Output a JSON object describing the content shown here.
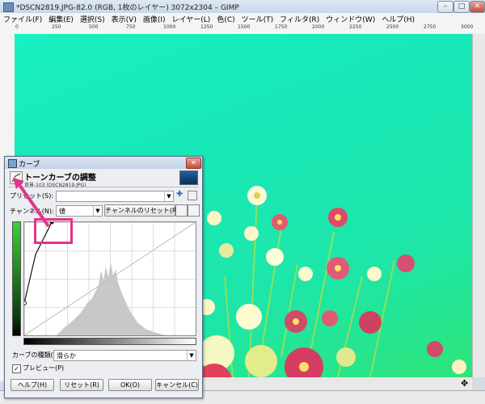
{
  "window": {
    "title": "*DSCN2819.JPG-82.0 (RGB, 1枚のレイヤー) 3072x2304 – GIMP"
  },
  "menu": [
    "ファイル(F)",
    "編集(E)",
    "選択(S)",
    "表示(V)",
    "画像(I)",
    "レイヤー(L)",
    "色(C)",
    "ツール(T)",
    "フィルタ(R)",
    "ウィンドウ(W)",
    "ヘルプ(H)"
  ],
  "ruler": {
    "h_ticks": [
      "0",
      "250",
      "500",
      "750",
      "1000",
      "1250",
      "1500",
      "1750",
      "2000",
      "2250",
      "2500",
      "2750",
      "3000"
    ]
  },
  "dialog": {
    "title": "カーブ",
    "header": "トーンカーブの調整",
    "subheader": "背景-103 (DSCN2819.JPG)",
    "preset_label": "プリセット(S):",
    "channel_label": "チャンネル(N):",
    "channel_value": "値",
    "channel_reset": "チャンネルのリセット(R)",
    "curve_type_label": "カーブの種類(T):",
    "curve_type_value": "滑らか",
    "preview_label": "プレビュー(P)",
    "buttons": {
      "help": "ヘルプ(H)",
      "reset": "リセット(R)",
      "ok": "OK(O)",
      "cancel": "キャンセル(C)"
    }
  },
  "colors": {
    "canvas": "#1ee8b0",
    "annotation": "#e0358a"
  }
}
